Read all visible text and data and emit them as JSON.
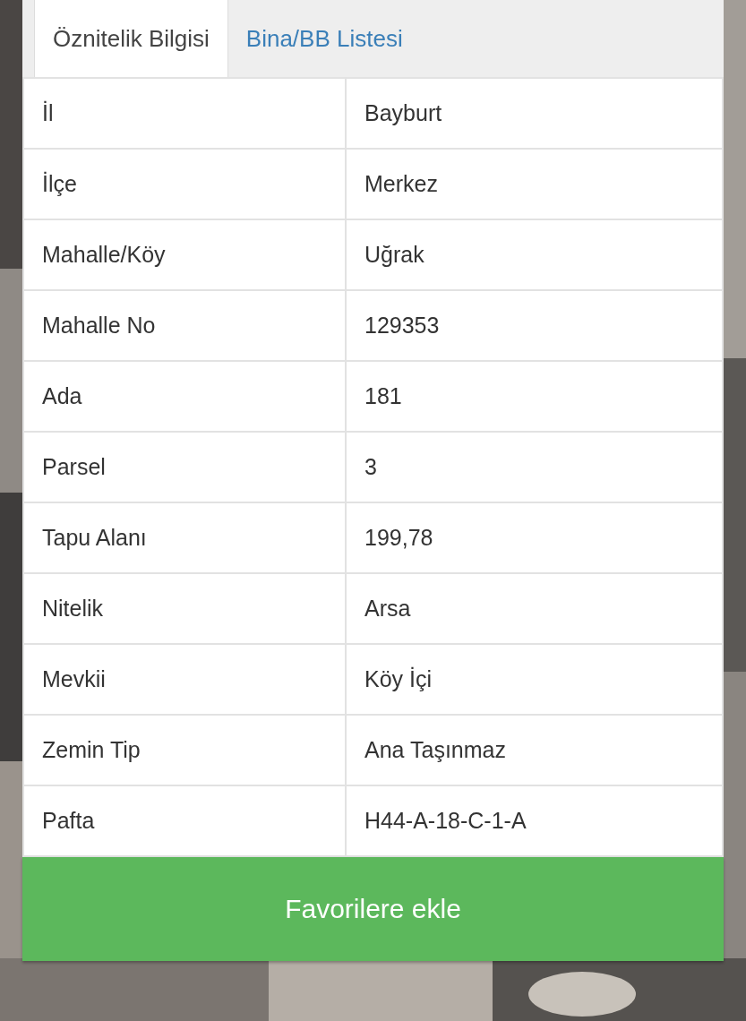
{
  "tabs": [
    {
      "label": "Öznitelik Bilgisi",
      "selected": true
    },
    {
      "label": "Bina/BB Listesi",
      "selected": false
    }
  ],
  "attributes": [
    {
      "label": "İl",
      "value": "Bayburt"
    },
    {
      "label": "İlçe",
      "value": "Merkez"
    },
    {
      "label": "Mahalle/Köy",
      "value": "Uğrak"
    },
    {
      "label": "Mahalle No",
      "value": "129353"
    },
    {
      "label": "Ada",
      "value": "181"
    },
    {
      "label": "Parsel",
      "value": "3"
    },
    {
      "label": "Tapu Alanı",
      "value": "199,78"
    },
    {
      "label": "Nitelik",
      "value": "Arsa"
    },
    {
      "label": "Mevkii",
      "value": "Köy İçi"
    },
    {
      "label": "Zemin Tip",
      "value": "Ana Taşınmaz"
    },
    {
      "label": "Pafta",
      "value": "H44-A-18-C-1-A"
    }
  ],
  "button": {
    "label": "Favorilere ekle"
  }
}
